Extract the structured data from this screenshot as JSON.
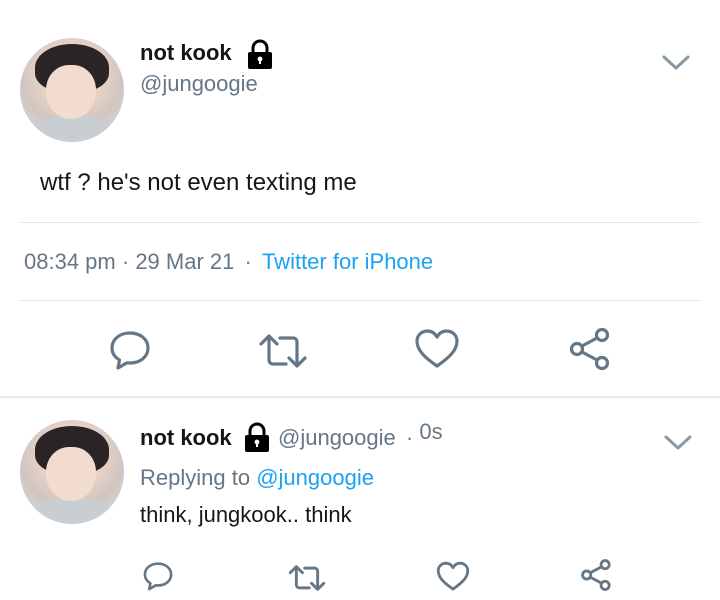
{
  "main_tweet": {
    "display_name": "not kook",
    "handle": "@jungoogie",
    "text": "wtf ? he's not even texting me",
    "time": "08:34 pm",
    "date": "29 Mar 21",
    "dot": "·",
    "client": "Twitter for iPhone",
    "actions": [
      "reply",
      "retweet",
      "like",
      "share"
    ]
  },
  "reply_tweet": {
    "display_name": "not kook",
    "handle": "@jungoogie",
    "dot": "·",
    "age": "0s",
    "replying_prefix": "Replying to",
    "replying_handle": "@jungoogie",
    "text": "think, jungkook.. think",
    "actions": [
      "reply",
      "retweet",
      "like",
      "share"
    ]
  },
  "colors": {
    "accent": "#1da1f2",
    "secondary_text": "#657786",
    "primary_text": "#14171a",
    "icon": "#657786",
    "divider": "#e1e8ed"
  },
  "icons": {
    "lock": "lock-icon",
    "chevron": "chevron-down-icon",
    "reply": "reply-icon",
    "retweet": "retweet-icon",
    "like": "heart-icon",
    "share": "share-icon"
  }
}
